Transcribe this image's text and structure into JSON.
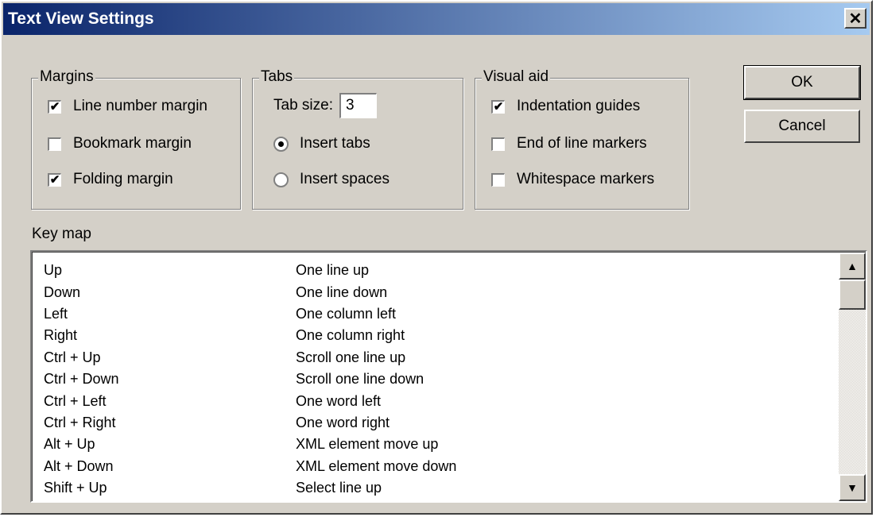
{
  "window": {
    "title": "Text View Settings"
  },
  "margins": {
    "legend": "Margins",
    "items": [
      {
        "label": "Line number margin",
        "checked": true
      },
      {
        "label": "Bookmark margin",
        "checked": false
      },
      {
        "label": "Folding margin",
        "checked": true
      }
    ]
  },
  "tabs": {
    "legend": "Tabs",
    "tab_size_label": "Tab size:",
    "tab_size_value": "3",
    "insert_tabs_label": "Insert tabs",
    "insert_spaces_label": "Insert spaces",
    "selected": "Insert tabs"
  },
  "visual_aid": {
    "legend": "Visual aid",
    "items": [
      {
        "label": "Indentation guides",
        "checked": true
      },
      {
        "label": "End of line markers",
        "checked": false
      },
      {
        "label": "Whitespace markers",
        "checked": false
      }
    ]
  },
  "buttons": {
    "ok": "OK",
    "cancel": "Cancel"
  },
  "keymap": {
    "label": "Key map",
    "rows": [
      {
        "key": "Up",
        "action": "One line up"
      },
      {
        "key": "Down",
        "action": "One line down"
      },
      {
        "key": "Left",
        "action": "One column left"
      },
      {
        "key": "Right",
        "action": "One column right"
      },
      {
        "key": "Ctrl + Up",
        "action": "Scroll one line up"
      },
      {
        "key": "Ctrl + Down",
        "action": "Scroll one line down"
      },
      {
        "key": "Ctrl + Left",
        "action": "One word left"
      },
      {
        "key": "Ctrl + Right",
        "action": "One word right"
      },
      {
        "key": "Alt + Up",
        "action": "XML element move up"
      },
      {
        "key": "Alt + Down",
        "action": "XML element move down"
      },
      {
        "key": "Shift + Up",
        "action": "Select line up"
      }
    ]
  },
  "icons": {
    "close": "close-icon",
    "check": "check-icon",
    "scroll_up": "arrow-up-icon",
    "scroll_down": "arrow-down-icon"
  },
  "colors": {
    "titlebar_start": "#0a246a",
    "titlebar_end": "#a6caf0",
    "dialog_bg": "#d4d0c8"
  }
}
